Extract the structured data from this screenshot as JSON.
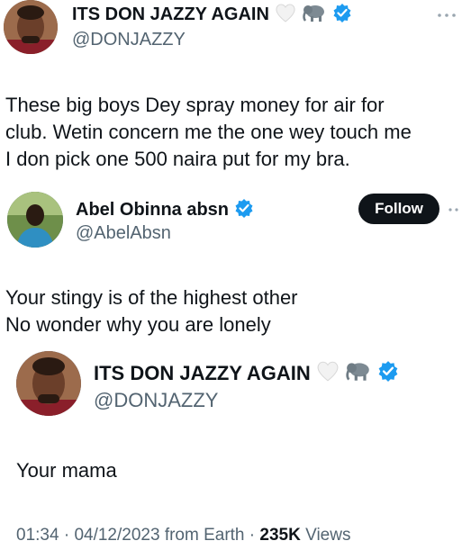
{
  "tweet1": {
    "display_name": "ITS DON JAZZY AGAIN",
    "handle": "@DONJAZZY",
    "text_lines": [
      "These big boys Dey spray money for air for",
      "club. Wetin concern me the one wey touch me",
      "I don pick one 500 naira put for my bra."
    ]
  },
  "tweet2": {
    "display_name": "Abel Obinna absn",
    "handle": "@AbelAbsn",
    "follow_label": "Follow",
    "text_lines": [
      "Your stingy is of the highest other",
      "No wonder why you are lonely"
    ]
  },
  "tweet3": {
    "display_name": "ITS DON JAZZY AGAIN",
    "handle": "@DONJAZZY",
    "text": "Your mama"
  },
  "footer": {
    "time": "01:34",
    "sep1": "·",
    "date": "04/12/2023",
    "source": "from Earth",
    "sep2": "·",
    "views_count": "235K",
    "views_label": "Views"
  },
  "icons": {
    "verified": "verified-badge-icon",
    "heart": "white-heart-icon",
    "elephant": "elephant-icon",
    "more": "more-dots-icon"
  },
  "colors": {
    "verified_blue": "#1d9bf0",
    "text": "#0f1419",
    "secondary": "#536471",
    "follow_bg": "#0f1419"
  }
}
